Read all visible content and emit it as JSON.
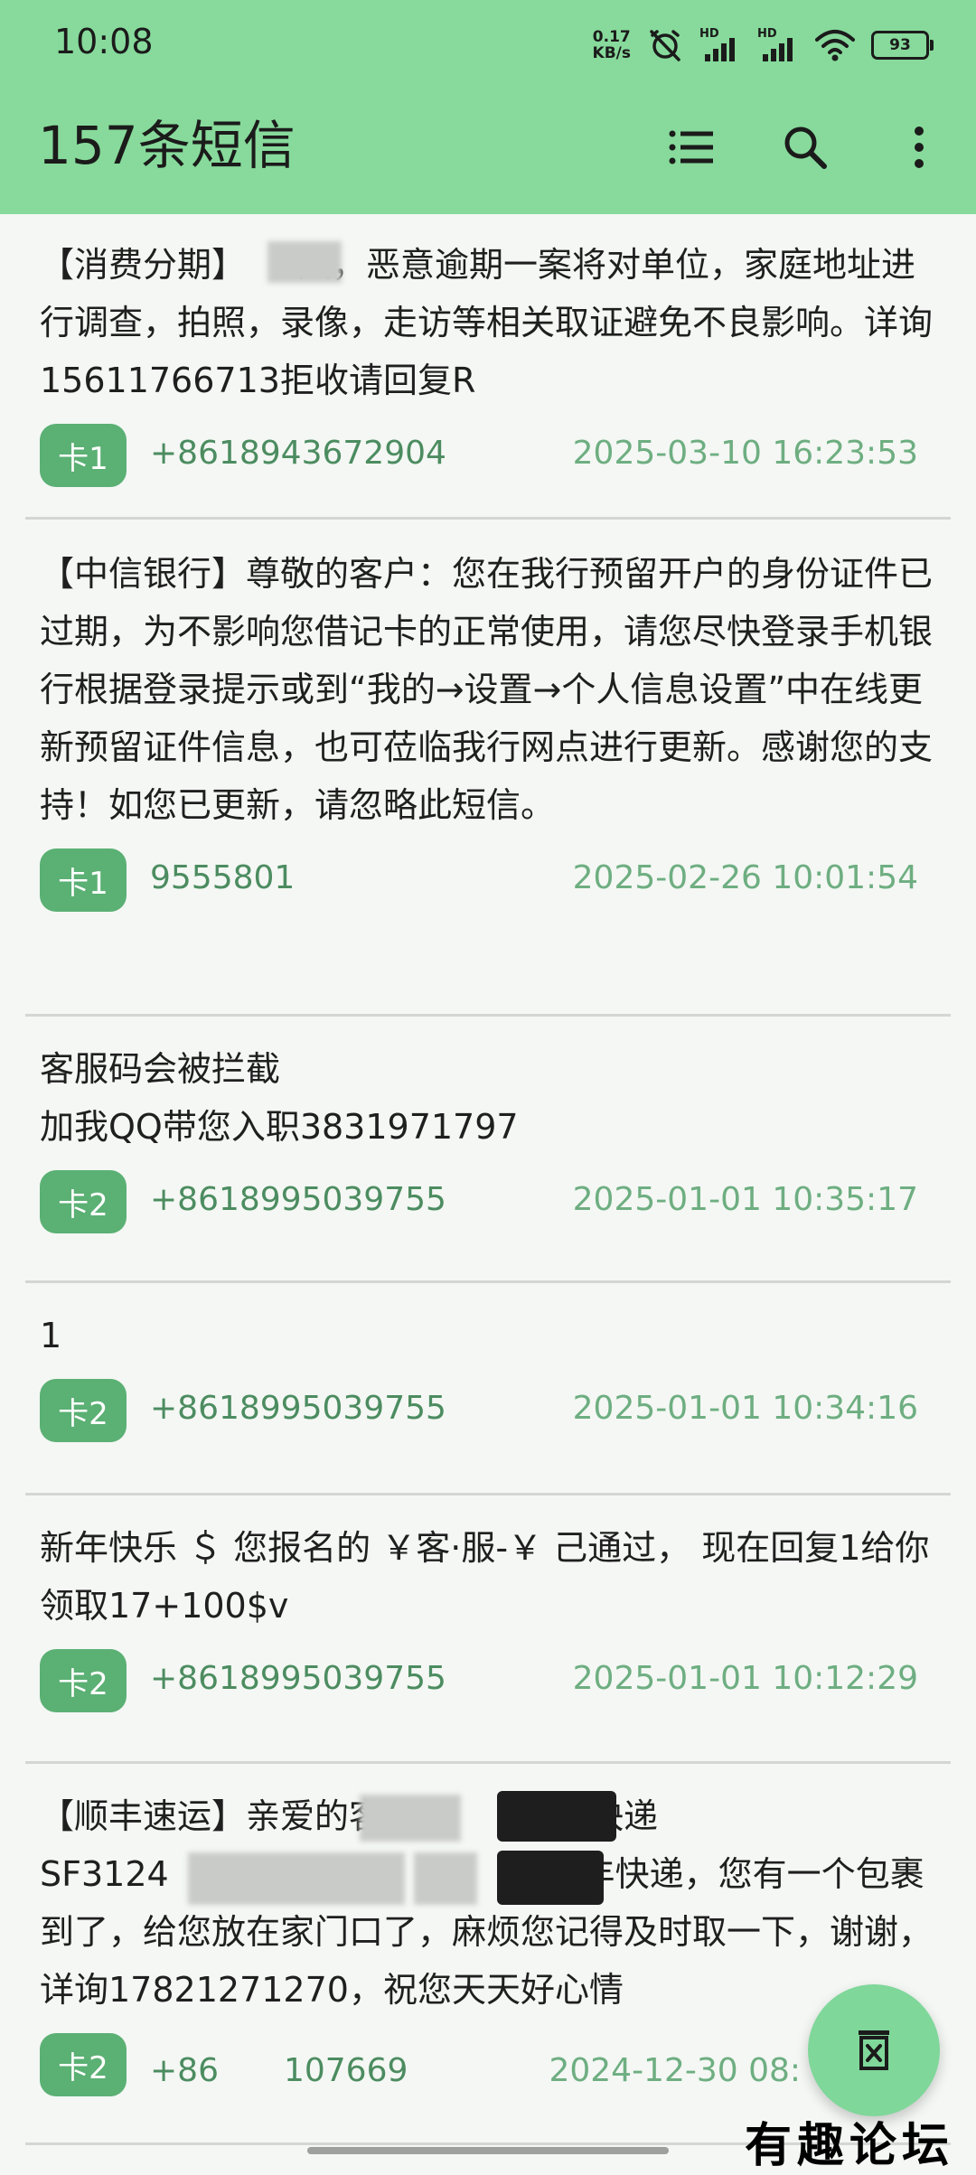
{
  "status_bar": {
    "time": "10:08",
    "net_speed_value": "0.17",
    "net_speed_unit": "KB/s",
    "hd1": "HD",
    "hd2": "HD",
    "battery": "93"
  },
  "app_bar": {
    "title": "157条短信",
    "icons": [
      "list-icon",
      "search-icon",
      "more-vert-icon"
    ]
  },
  "messages": [
    {
      "body": "【消费分期】　　天，恶意逾期一案将对单位，家庭地址进行调查，拍照，录像，走访等相关取证避免不良影响。详询15611766713拒收请回复R",
      "sim": "卡1",
      "sender": "+8618943672904",
      "time": "2025-03-10 16:23:53"
    },
    {
      "body": "【中信银行】尊敬的客户：您在我行预留开户的身份证件已过期，为不影响您借记卡的正常使用，请您尽快登录手机银行根据登录提示或到“我的→设置→个人信息设置”中在线更新预留证件信息，也可莅临我行网点进行更新。感谢您的支持！如您已更新，请忽略此短信。",
      "sim": "卡1",
      "sender": "9555801",
      "time": "2025-02-26 10:01:54"
    },
    {
      "body": "客服码会被拦截\n加我QQ带您入职3831971797",
      "sim": "卡2",
      "sender": "+8618995039755",
      "time": "2025-01-01 10:35:17"
    },
    {
      "body": "1",
      "sim": "卡2",
      "sender": "+8618995039755",
      "time": "2025-01-01 10:34:16"
    },
    {
      "body": "新年快乐 ＄ 您报名的 ￥客·服-￥ 己通过， 现在回复1给你领取17+100$v",
      "sim": "卡2",
      "sender": "+8618995039755",
      "time": "2025-01-01 10:12:29"
    },
    {
      "body": "【顺丰速运】亲爱的客户　　　你的快递SF3124　　　　　　　　　　，顺丰快递，您有一个包裹到了，给您放在家门口了，麻烦您记得及时取一下，谢谢，详询17821271270，祝您天天好心情",
      "sim": "卡2",
      "sender": "+86　　107669",
      "time": "2024-12-30 08:　　:12"
    }
  ],
  "fab": {
    "icon": "delete-all-icon"
  },
  "watermark": "有趣论坛",
  "colors": {
    "app_bar": "#87da9b",
    "sim_badge": "#5bb074",
    "sender_text": "#4c8c60",
    "time_text": "#6eae81",
    "fab": "#7fd79a"
  }
}
